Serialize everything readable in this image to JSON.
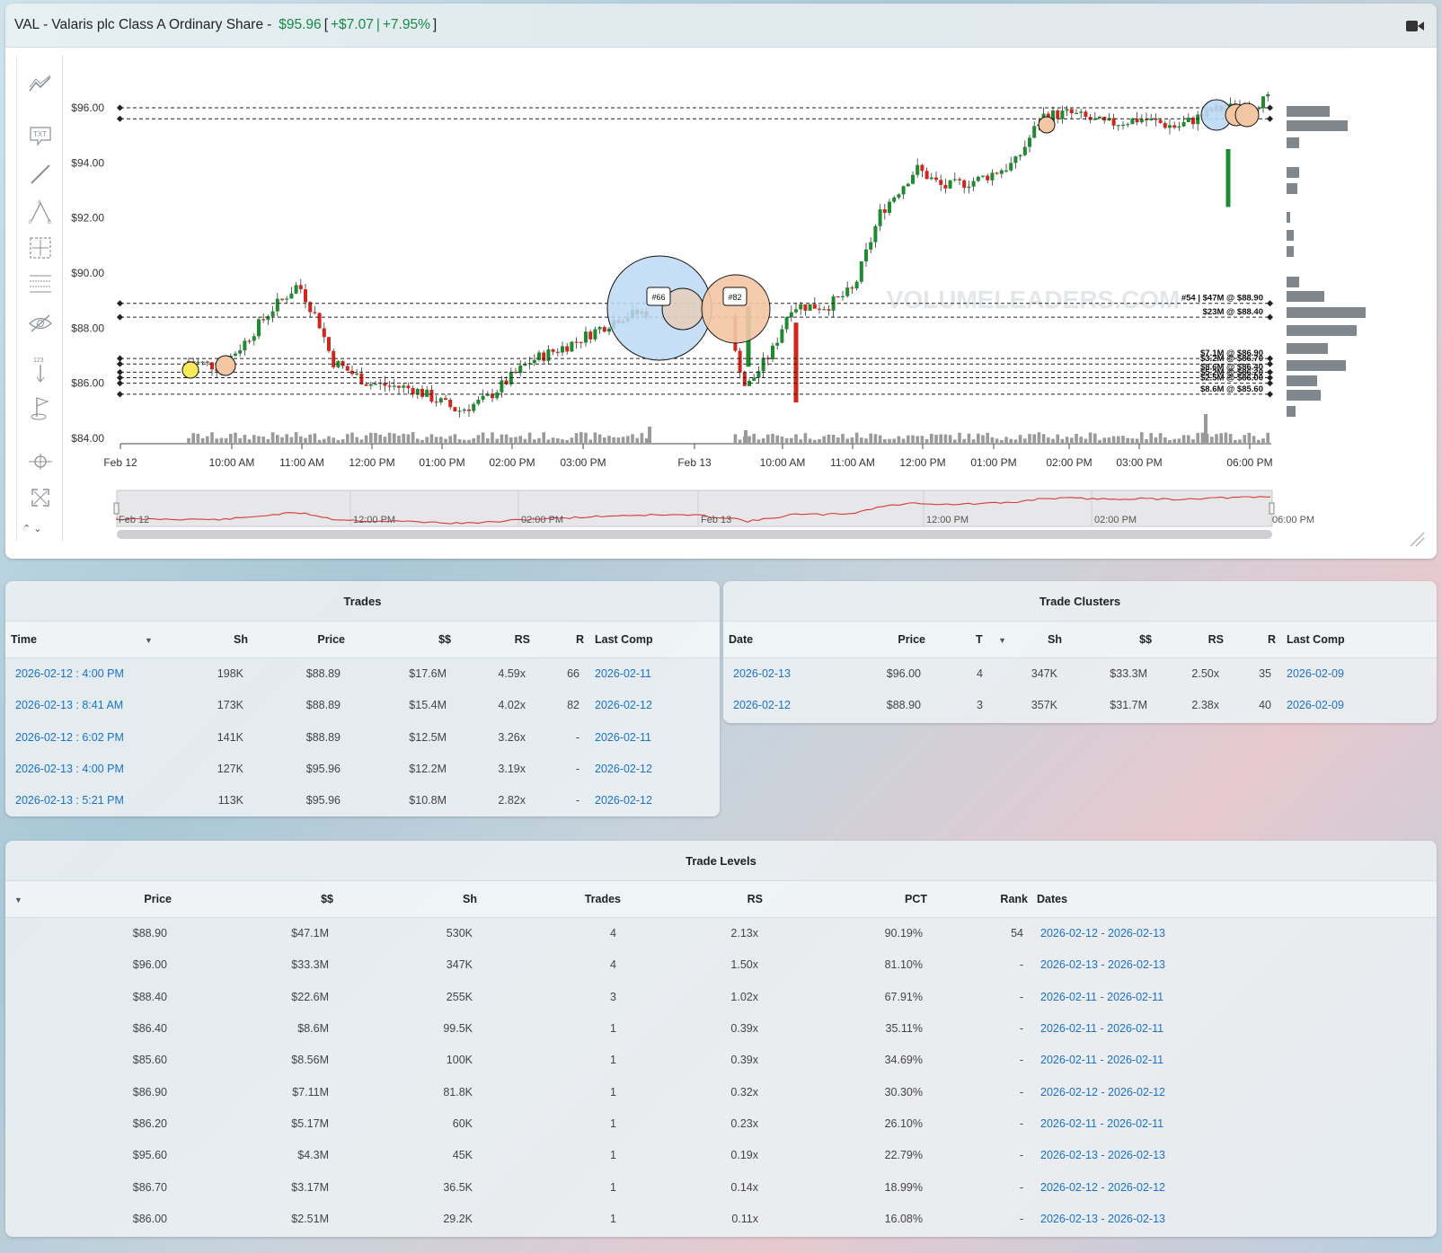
{
  "header": {
    "ticker": "VAL",
    "company": "Valaris plc Class A Ordinary Share",
    "separator": "-",
    "price": "$95.96",
    "change": "+$7.07",
    "change_pct": "+7.95%",
    "open_bracket": "[",
    "close_bracket": "]",
    "pipe": "|",
    "video_icon": "video-camera-icon"
  },
  "toolbar": {
    "icons": [
      "trend-lines-icon",
      "text-note-icon",
      "line-tool-icon",
      "triangle-pattern-icon",
      "measure-box-icon",
      "fib-levels-icon",
      "hide-eye-icon",
      "ruler-count-icon",
      "flag-marker-icon",
      "crosshair-icon",
      "fullscreen-icon"
    ],
    "txt_label": "TXT",
    "count_label": "123"
  },
  "chart_data": {
    "type": "candlestick",
    "y_ticks": [
      "$96.00",
      "$94.00",
      "$92.00",
      "$90.00",
      "$88.00",
      "$86.00",
      "$84.00"
    ],
    "ylim": [
      83.8,
      97.3
    ],
    "x_ticks": [
      "Feb 12",
      "10:00 AM",
      "11:00 AM",
      "12:00 PM",
      "01:00 PM",
      "02:00 PM",
      "03:00 PM",
      "Feb 13",
      "10:00 AM",
      "11:00 AM",
      "12:00 PM",
      "01:00 PM",
      "02:00 PM",
      "03:00 PM",
      "06:00 PM"
    ],
    "watermark": "VOLUMELEADERS.COM",
    "levels": [
      {
        "price": 96.0,
        "label": ""
      },
      {
        "price": 95.6,
        "label": ""
      },
      {
        "price": 88.9,
        "label": "#54 | $47M @ $88.90"
      },
      {
        "price": 88.4,
        "label": "$23M @ $88.40"
      },
      {
        "price": 86.9,
        "label": "$7.1M @ $86.90"
      },
      {
        "price": 86.7,
        "label": "$3.2M @ $86.70"
      },
      {
        "price": 86.4,
        "label": "$8.6M @ $86.40"
      },
      {
        "price": 86.2,
        "label": "$5.2M @ $86.20"
      },
      {
        "price": 86.0,
        "label": "$2.5M @ $86.00"
      },
      {
        "price": 85.6,
        "label": "$8.6M @ $85.60"
      }
    ],
    "bubbles": [
      {
        "label": "#66",
        "price": 88.6,
        "color": "blue"
      },
      {
        "label": "#82",
        "price": 88.6,
        "color": "orange"
      }
    ],
    "volume_profile_note": "horizontal volume bars on right",
    "navigator_labels": [
      "Feb 12",
      "12:00 PM",
      "02:00 PM",
      "Feb 13",
      "12:00 PM",
      "02:00 PM",
      "06:00 PM"
    ]
  },
  "trades": {
    "title": "Trades",
    "columns": [
      "Time",
      "Sh",
      "Price",
      "$$",
      "RS",
      "R",
      "Last Comp"
    ],
    "rows": [
      {
        "time": "2026-02-12 : 4:00 PM",
        "sh": "198K",
        "price": "$88.89",
        "dollars": "$17.6M",
        "rs": "4.59x",
        "r": "66",
        "last": "2026-02-11"
      },
      {
        "time": "2026-02-13 : 8:41 AM",
        "sh": "173K",
        "price": "$88.89",
        "dollars": "$15.4M",
        "rs": "4.02x",
        "r": "82",
        "last": "2026-02-12"
      },
      {
        "time": "2026-02-12 : 6:02 PM",
        "sh": "141K",
        "price": "$88.89",
        "dollars": "$12.5M",
        "rs": "3.26x",
        "r": "-",
        "last": "2026-02-11"
      },
      {
        "time": "2026-02-13 : 4:00 PM",
        "sh": "127K",
        "price": "$95.96",
        "dollars": "$12.2M",
        "rs": "3.19x",
        "r": "-",
        "last": "2026-02-12"
      },
      {
        "time": "2026-02-13 : 5:21 PM",
        "sh": "113K",
        "price": "$95.96",
        "dollars": "$10.8M",
        "rs": "2.82x",
        "r": "-",
        "last": "2026-02-12"
      }
    ]
  },
  "clusters": {
    "title": "Trade Clusters",
    "columns": [
      "Date",
      "Price",
      "T",
      "Sh",
      "$$",
      "RS",
      "R",
      "Last Comp"
    ],
    "rows": [
      {
        "date": "2026-02-13",
        "price": "$96.00",
        "t": "4",
        "sh": "347K",
        "dollars": "$33.3M",
        "rs": "2.50x",
        "r": "35",
        "last": "2026-02-09"
      },
      {
        "date": "2026-02-12",
        "price": "$88.90",
        "t": "3",
        "sh": "357K",
        "dollars": "$31.7M",
        "rs": "2.38x",
        "r": "40",
        "last": "2026-02-09"
      }
    ]
  },
  "levels": {
    "title": "Trade Levels",
    "columns": [
      "Price",
      "$$",
      "Sh",
      "Trades",
      "RS",
      "PCT",
      "Rank",
      "Dates"
    ],
    "rows": [
      {
        "price": "$88.90",
        "dollars": "$47.1M",
        "sh": "530K",
        "trades": "4",
        "rs": "2.13x",
        "pct": "90.19%",
        "rank": "54",
        "dates": "2026-02-12 - 2026-02-13"
      },
      {
        "price": "$96.00",
        "dollars": "$33.3M",
        "sh": "347K",
        "trades": "4",
        "rs": "1.50x",
        "pct": "81.10%",
        "rank": "-",
        "dates": "2026-02-13 - 2026-02-13"
      },
      {
        "price": "$88.40",
        "dollars": "$22.6M",
        "sh": "255K",
        "trades": "3",
        "rs": "1.02x",
        "pct": "67.91%",
        "rank": "-",
        "dates": "2026-02-11 - 2026-02-11"
      },
      {
        "price": "$86.40",
        "dollars": "$8.6M",
        "sh": "99.5K",
        "trades": "1",
        "rs": "0.39x",
        "pct": "35.11%",
        "rank": "-",
        "dates": "2026-02-11 - 2026-02-11"
      },
      {
        "price": "$85.60",
        "dollars": "$8.56M",
        "sh": "100K",
        "trades": "1",
        "rs": "0.39x",
        "pct": "34.69%",
        "rank": "-",
        "dates": "2026-02-11 - 2026-02-11"
      },
      {
        "price": "$86.90",
        "dollars": "$7.11M",
        "sh": "81.8K",
        "trades": "1",
        "rs": "0.32x",
        "pct": "30.30%",
        "rank": "-",
        "dates": "2026-02-12 - 2026-02-12"
      },
      {
        "price": "$86.20",
        "dollars": "$5.17M",
        "sh": "60K",
        "trades": "1",
        "rs": "0.23x",
        "pct": "26.10%",
        "rank": "-",
        "dates": "2026-02-11 - 2026-02-11"
      },
      {
        "price": "$95.60",
        "dollars": "$4.3M",
        "sh": "45K",
        "trades": "1",
        "rs": "0.19x",
        "pct": "22.79%",
        "rank": "-",
        "dates": "2026-02-13 - 2026-02-13"
      },
      {
        "price": "$86.70",
        "dollars": "$3.17M",
        "sh": "36.5K",
        "trades": "1",
        "rs": "0.14x",
        "pct": "18.99%",
        "rank": "-",
        "dates": "2026-02-12 - 2026-02-12"
      },
      {
        "price": "$86.00",
        "dollars": "$2.51M",
        "sh": "29.2K",
        "trades": "1",
        "rs": "0.11x",
        "pct": "16.08%",
        "rank": "-",
        "dates": "2026-02-13 - 2026-02-13"
      }
    ]
  }
}
